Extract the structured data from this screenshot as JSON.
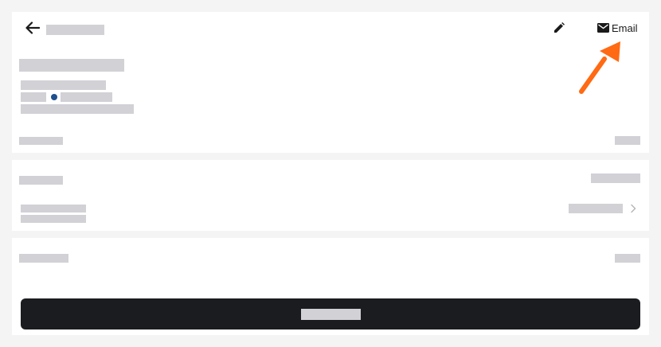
{
  "header": {
    "back_icon": "arrow-left-icon",
    "edit_icon": "pencil-icon",
    "email_icon": "envelope-icon",
    "email_label": "Email"
  },
  "details": {
    "status_dot_color": "#1f4f8e"
  },
  "row2": {
    "chevron_icon": "chevron-right-icon"
  },
  "annotation": {
    "arrow_color": "#ff6a13"
  }
}
